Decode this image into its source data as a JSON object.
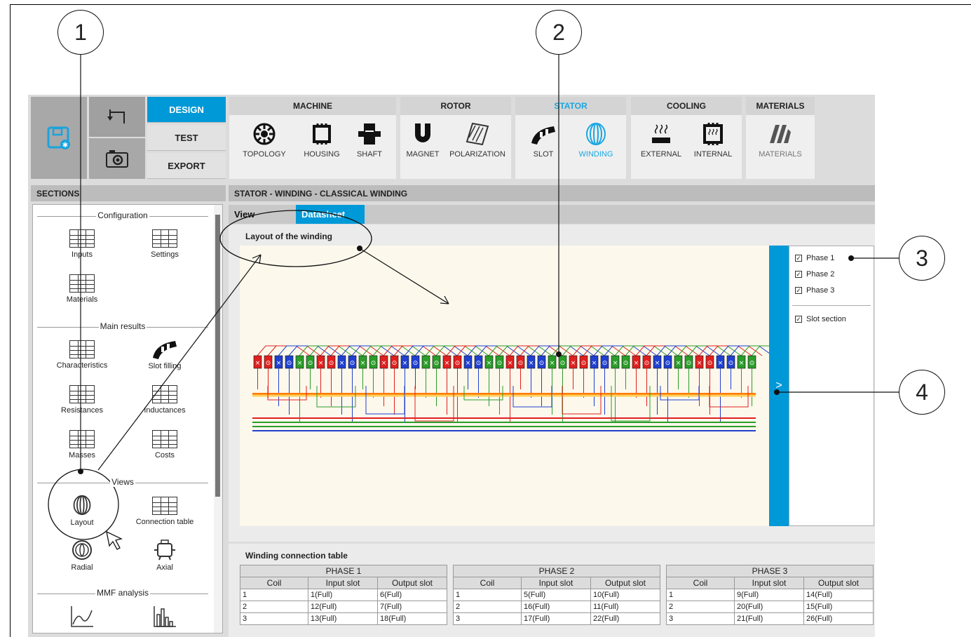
{
  "modes": {
    "design": "DESIGN",
    "test": "TEST",
    "export": "EXPORT"
  },
  "toolbar_groups": [
    {
      "title": "MACHINE",
      "items": [
        "TOPOLOGY",
        "HOUSING",
        "SHAFT"
      ]
    },
    {
      "title": "ROTOR",
      "items": [
        "MAGNET",
        "POLARIZATION"
      ]
    },
    {
      "title": "STATOR",
      "items": [
        "SLOT",
        "WINDING"
      ]
    },
    {
      "title": "COOLING",
      "items": [
        "EXTERNAL",
        "INTERNAL"
      ]
    },
    {
      "title": "MATERIALS",
      "items": [
        "MATERIALS"
      ]
    }
  ],
  "sidebar": {
    "title": "SECTIONS",
    "groups": [
      {
        "title": "Configuration",
        "items": [
          "Inputs",
          "Settings",
          "Materials"
        ]
      },
      {
        "title": "Main results",
        "items": [
          "Characteristics",
          "Slot filling",
          "Resistances",
          "Inductances",
          "Masses",
          "Costs"
        ]
      },
      {
        "title": "Views",
        "items": [
          "Layout",
          "Connection table",
          "Radial",
          "Axial"
        ]
      },
      {
        "title": "MMF analysis",
        "items": []
      }
    ]
  },
  "main": {
    "breadcrumb": "STATOR - WINDING - CLASSICAL WINDING",
    "tabs": [
      "View",
      "Datasheet"
    ],
    "layout_title": "Layout of the winding",
    "legend": [
      "Phase 1",
      "Phase 2",
      "Phase 3",
      "Slot section"
    ],
    "expand_glyph": ">"
  },
  "winding_table": {
    "title": "Winding connection table",
    "columns": [
      "Coil",
      "Input slot",
      "Output slot"
    ],
    "phases": [
      {
        "name": "PHASE 1",
        "rows": [
          [
            "1",
            "1(Full)",
            "6(Full)"
          ],
          [
            "2",
            "12(Full)",
            "7(Full)"
          ],
          [
            "3",
            "13(Full)",
            "18(Full)"
          ]
        ]
      },
      {
        "name": "PHASE 2",
        "rows": [
          [
            "1",
            "5(Full)",
            "10(Full)"
          ],
          [
            "2",
            "16(Full)",
            "11(Full)"
          ],
          [
            "3",
            "17(Full)",
            "22(Full)"
          ]
        ]
      },
      {
        "name": "PHASE 3",
        "rows": [
          [
            "1",
            "9(Full)",
            "14(Full)"
          ],
          [
            "2",
            "20(Full)",
            "15(Full)"
          ],
          [
            "3",
            "21(Full)",
            "26(Full)"
          ]
        ]
      }
    ]
  },
  "callouts": [
    "1",
    "2",
    "3",
    "4"
  ],
  "colors": {
    "accent": "#0099d8",
    "phase1": "#e02020",
    "phase2": "#2a9d2a",
    "phase3": "#2040d0",
    "bus": "#ff7a00"
  }
}
